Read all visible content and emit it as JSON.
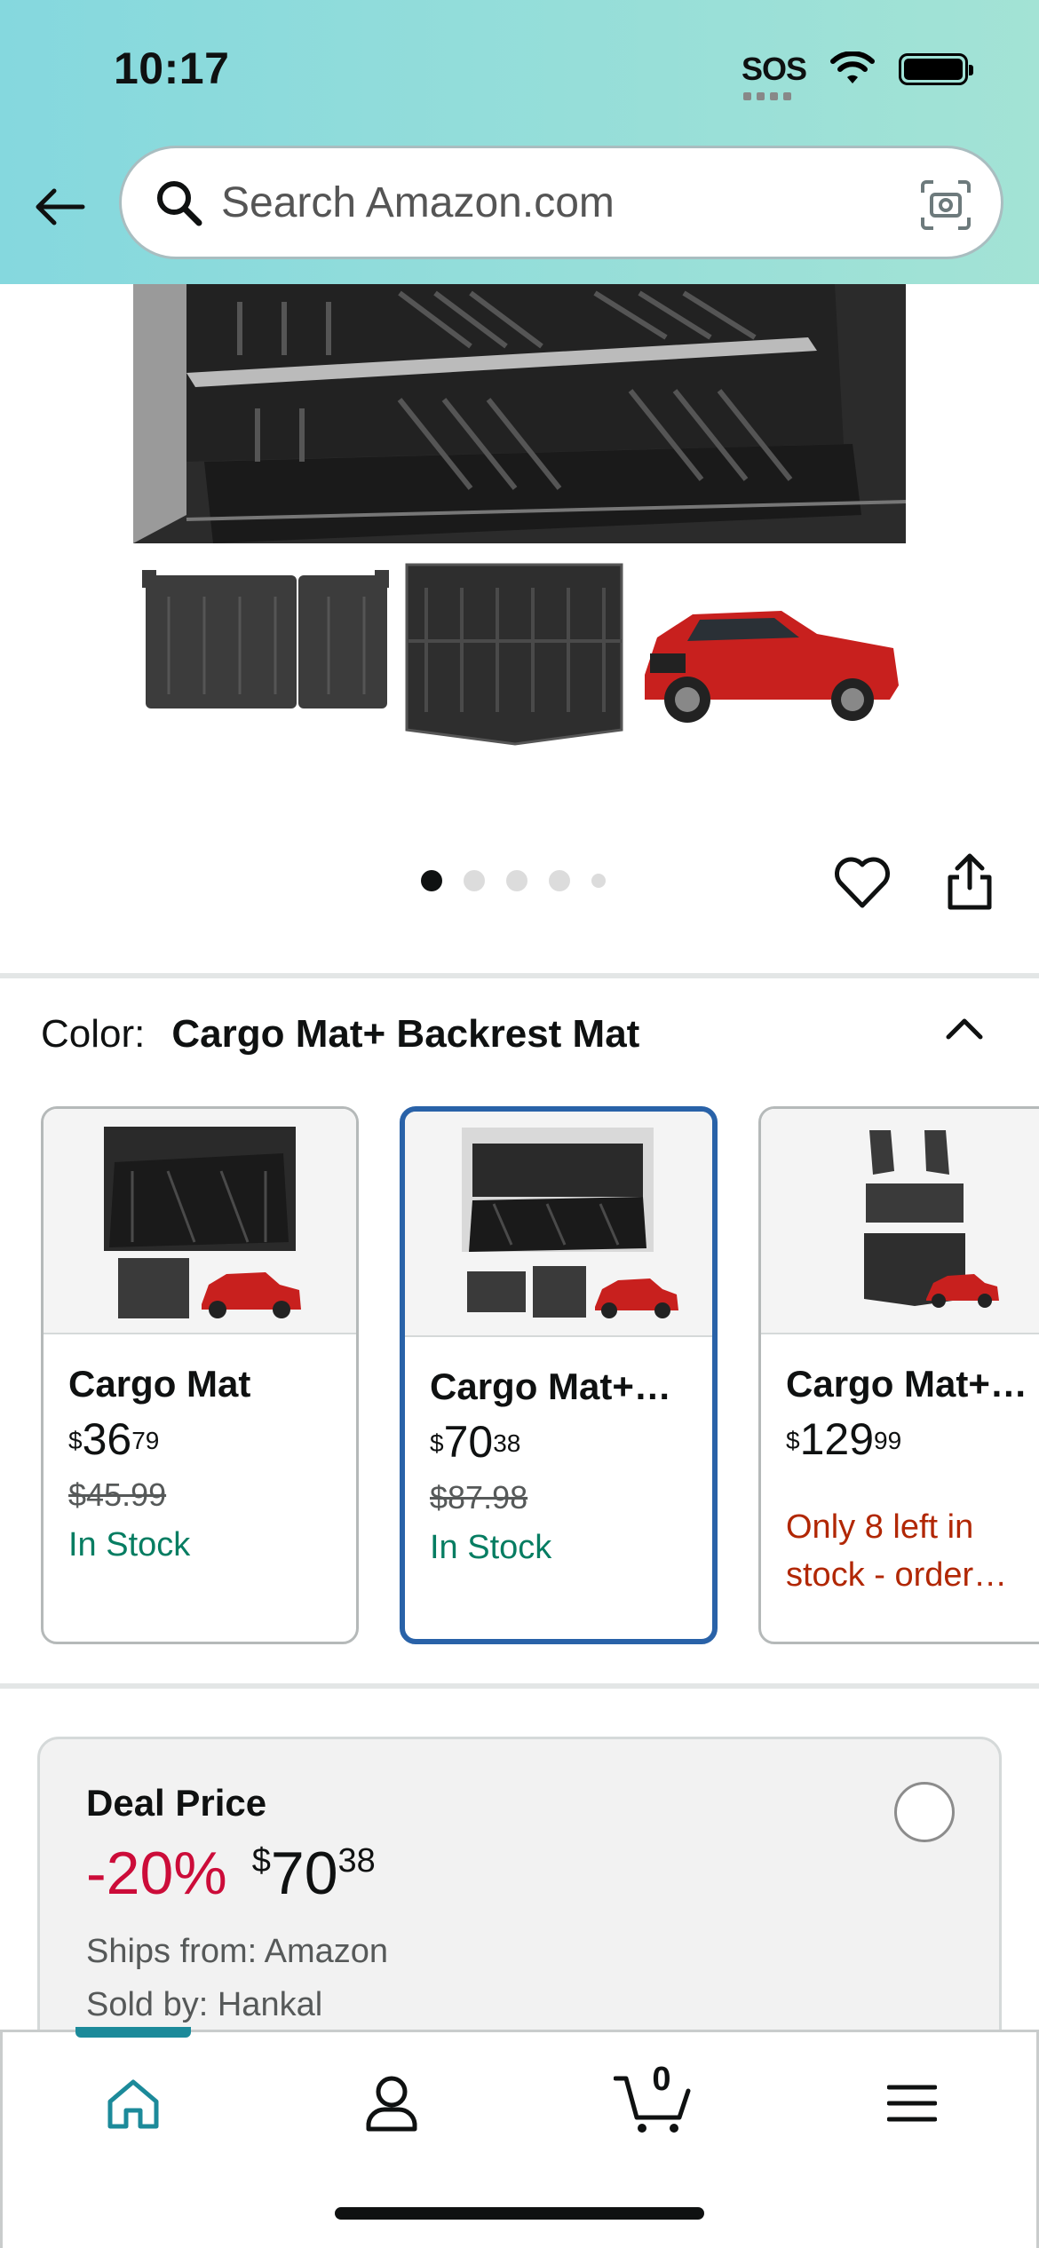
{
  "status_bar": {
    "time": "10:17",
    "sos": "SOS",
    "icons": [
      "wifi-icon",
      "battery-icon"
    ]
  },
  "header": {
    "back_icon": "arrow-left-icon",
    "search": {
      "placeholder": "Search Amazon.com",
      "value": "",
      "icons": [
        "search-icon",
        "camera-scan-icon"
      ]
    }
  },
  "gallery": {
    "dot_count": 5,
    "active_dot": 1,
    "actions": [
      "heart-icon",
      "share-icon"
    ]
  },
  "color": {
    "label": "Color:",
    "selected": "Cargo Mat+ Backrest Mat",
    "collapse_icon": "chevron-up-icon"
  },
  "swatches": [
    {
      "title": "Cargo Mat",
      "price_symbol": "$",
      "price_whole": "36",
      "price_fraction": "79",
      "list_price": "$45.99",
      "stock": "In Stock",
      "selected": false
    },
    {
      "title": "Cargo Mat+…",
      "price_symbol": "$",
      "price_whole": "70",
      "price_fraction": "38",
      "list_price": "$87.98",
      "stock": "In Stock",
      "selected": true
    },
    {
      "title": "Cargo Mat+…",
      "price_symbol": "$",
      "price_whole": "129",
      "price_fraction": "99",
      "list_price": "",
      "stock": "Only 8 left in stock - order…",
      "selected": false
    }
  ],
  "deal": {
    "title": "Deal Price",
    "discount": "-20%",
    "price_symbol": "$",
    "price_whole": "70",
    "price_fraction": "38",
    "ships_from": "Ships from: Amazon",
    "sold_by": "Sold by: Hankal"
  },
  "bottom_nav": {
    "items": [
      "home-icon",
      "account-icon",
      "cart-icon",
      "menu-icon"
    ],
    "cart_count": "0",
    "active": "home"
  },
  "colors": {
    "header_gradient_start": "#85d8de",
    "header_gradient_end": "#a3e3d5",
    "selected_border": "#2962a8",
    "in_stock": "#067d62",
    "low_stock": "#b12704",
    "discount": "#cc0c39",
    "nav_active": "#1c8a9a"
  }
}
